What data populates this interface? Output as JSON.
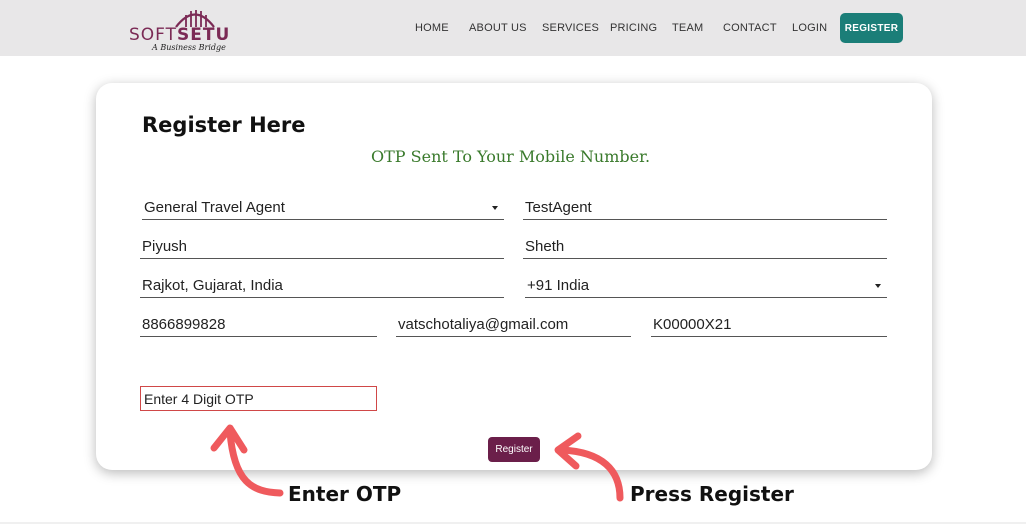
{
  "brand": {
    "name_part1": "SOFT",
    "name_part2": "SETU",
    "tagline": "A Business Bridge",
    "color": "#7b2a55"
  },
  "nav": {
    "items": [
      "HOME",
      "ABOUT US",
      "SERVICES",
      "PRICING",
      "TEAM",
      "CONTACT",
      "LOGIN"
    ],
    "register_label": "REGISTER",
    "register_color": "#1b7e78"
  },
  "form": {
    "title": "Register Here",
    "otp_message": "OTP Sent To Your Mobile Number.",
    "agent_type": "General Travel Agent",
    "username": "TestAgent",
    "first_name": "Piyush",
    "last_name": "Sheth",
    "location": "Rajkot, Gujarat, India",
    "country_code": "+91 India",
    "mobile": "8866899828",
    "email": "vatschotaliya@gmail.com",
    "code": "K00000X21",
    "otp_placeholder": "Enter 4 Digit OTP",
    "submit_label": "Register",
    "submit_color": "#6b1f4a"
  },
  "annotations": {
    "otp_hint": "Enter OTP",
    "register_hint": "Press Register",
    "arrow_color": "#ef5a5d"
  }
}
